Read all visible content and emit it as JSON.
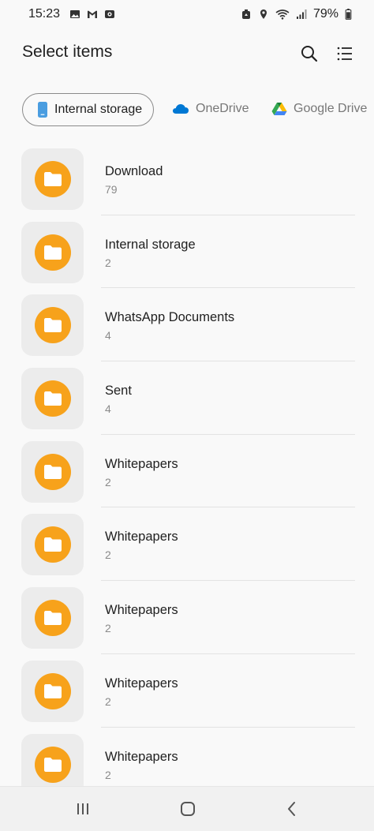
{
  "status_bar": {
    "time": "15:23",
    "battery_percent": "79%",
    "left_icons": [
      "gallery-icon",
      "gmail-icon",
      "camera-notification-icon"
    ],
    "right_icons": [
      "recycle-icon",
      "location-icon",
      "wifi-icon",
      "signal-icon",
      "battery-icon"
    ]
  },
  "header": {
    "title": "Select items",
    "search_icon": "search-icon",
    "list_view_icon": "list-view-icon"
  },
  "storage_chips": [
    {
      "label": "Internal storage",
      "icon": "phone-icon",
      "selected": true
    },
    {
      "label": "OneDrive",
      "icon": "onedrive-icon",
      "selected": false
    },
    {
      "label": "Google Drive",
      "icon": "google-drive-icon",
      "selected": false
    }
  ],
  "folders": [
    {
      "name": "Download",
      "count": "79"
    },
    {
      "name": "Internal storage",
      "count": "2"
    },
    {
      "name": "WhatsApp Documents",
      "count": "4"
    },
    {
      "name": "Sent",
      "count": "4"
    },
    {
      "name": "Whitepapers",
      "count": "2"
    },
    {
      "name": "Whitepapers",
      "count": "2"
    },
    {
      "name": "Whitepapers",
      "count": "2"
    },
    {
      "name": "Whitepapers",
      "count": "2"
    },
    {
      "name": "Whitepapers",
      "count": "2"
    }
  ],
  "nav_bar": {
    "recents_icon": "recents-icon",
    "home_icon": "home-icon",
    "back_icon": "back-icon"
  },
  "colors": {
    "folder_accent": "#f7a21b",
    "folder_tile": "#ececec",
    "onedrive_blue": "#0078d4",
    "phone_blue": "#4a9de0"
  }
}
